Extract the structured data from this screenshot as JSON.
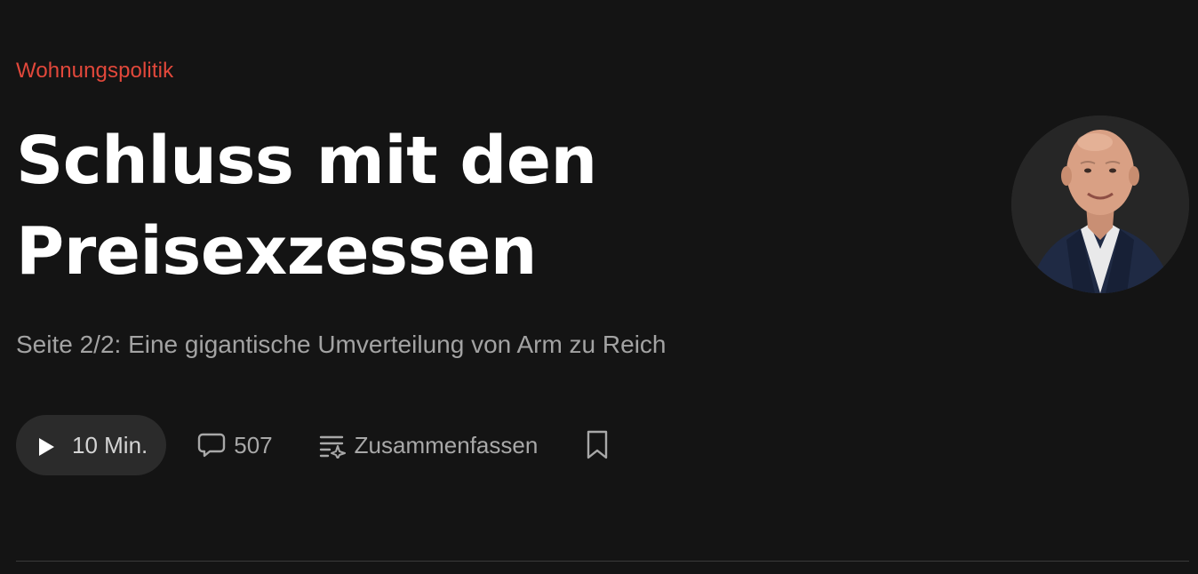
{
  "article": {
    "kicker": "Wohnungspolitik",
    "headline_line1": "Schluss mit den",
    "headline_line2": "Preisexzessen",
    "subtitle": "Seite 2/2: Eine gigantische Umverteilung von Arm zu Reich"
  },
  "actions": {
    "listen_label": "10 Min.",
    "comments_count": "507",
    "summarize_label": "Zusammenfassen"
  },
  "icons": {
    "play": "play-icon",
    "comments": "speech-bubble-icon",
    "summarize": "ai-summary-icon",
    "bookmark": "bookmark-icon"
  },
  "colors": {
    "background": "#141414",
    "kicker": "#e2483b",
    "headline": "#ffffff",
    "subtitle": "#a3a3a3",
    "pill": "#2b2b2b"
  }
}
